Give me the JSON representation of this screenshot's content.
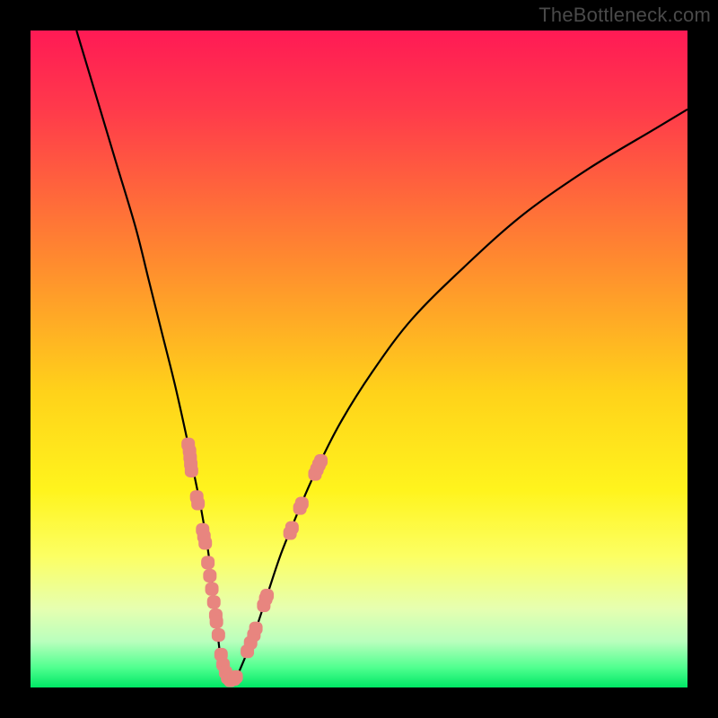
{
  "watermark": "TheBottleneck.com",
  "colors": {
    "curve_stroke": "#000000",
    "marker_fill": "#e8857f",
    "gradient_stops": [
      {
        "offset": "0%",
        "color": "#ff1a55"
      },
      {
        "offset": "12%",
        "color": "#ff3a4b"
      },
      {
        "offset": "35%",
        "color": "#ff8a2f"
      },
      {
        "offset": "55%",
        "color": "#ffd21a"
      },
      {
        "offset": "70%",
        "color": "#fff41d"
      },
      {
        "offset": "80%",
        "color": "#fcff63"
      },
      {
        "offset": "88%",
        "color": "#e6ffb0"
      },
      {
        "offset": "93%",
        "color": "#b9ffbd"
      },
      {
        "offset": "97%",
        "color": "#4fff8f"
      },
      {
        "offset": "100%",
        "color": "#00e765"
      }
    ]
  },
  "chart_data": {
    "type": "line",
    "title": "",
    "xlabel": "",
    "ylabel": "",
    "xlim": [
      0,
      100
    ],
    "ylim": [
      0,
      100
    ],
    "series": [
      {
        "name": "bottleneck-curve",
        "x": [
          7,
          10,
          13,
          16,
          18,
          20,
          22,
          24,
          25,
          26,
          27,
          27.5,
          28,
          28.5,
          29,
          29.5,
          30,
          31,
          32,
          34,
          36,
          38,
          40,
          43,
          47,
          52,
          58,
          66,
          75,
          85,
          95,
          100
        ],
        "y": [
          100,
          90,
          80,
          70,
          62,
          54,
          46,
          37,
          32,
          27,
          21,
          17,
          12,
          8,
          4,
          2,
          1,
          1,
          3,
          8,
          14,
          20,
          25,
          32,
          40,
          48,
          56,
          64,
          72,
          79,
          85,
          88
        ]
      }
    ],
    "markers": {
      "name": "highlight-points",
      "points": [
        {
          "x": 24.0,
          "y": 37
        },
        {
          "x": 24.2,
          "y": 36
        },
        {
          "x": 24.3,
          "y": 35
        },
        {
          "x": 24.4,
          "y": 34
        },
        {
          "x": 24.5,
          "y": 33
        },
        {
          "x": 25.3,
          "y": 29
        },
        {
          "x": 25.5,
          "y": 28
        },
        {
          "x": 26.2,
          "y": 24
        },
        {
          "x": 26.4,
          "y": 23
        },
        {
          "x": 26.6,
          "y": 22
        },
        {
          "x": 27.0,
          "y": 19
        },
        {
          "x": 27.3,
          "y": 17
        },
        {
          "x": 27.6,
          "y": 15
        },
        {
          "x": 27.9,
          "y": 13
        },
        {
          "x": 28.2,
          "y": 11
        },
        {
          "x": 28.3,
          "y": 10
        },
        {
          "x": 28.6,
          "y": 8
        },
        {
          "x": 29.0,
          "y": 5
        },
        {
          "x": 29.3,
          "y": 3.5
        },
        {
          "x": 29.7,
          "y": 2.3
        },
        {
          "x": 30.0,
          "y": 1.5
        },
        {
          "x": 30.4,
          "y": 1.1
        },
        {
          "x": 31.0,
          "y": 1.3
        },
        {
          "x": 31.3,
          "y": 1.6
        },
        {
          "x": 33.0,
          "y": 5.5
        },
        {
          "x": 33.5,
          "y": 6.8
        },
        {
          "x": 34.0,
          "y": 8
        },
        {
          "x": 34.3,
          "y": 9
        },
        {
          "x": 35.5,
          "y": 12.5
        },
        {
          "x": 35.8,
          "y": 13.5
        },
        {
          "x": 36.0,
          "y": 14
        },
        {
          "x": 39.5,
          "y": 23.5
        },
        {
          "x": 39.8,
          "y": 24.3
        },
        {
          "x": 41.0,
          "y": 27.3
        },
        {
          "x": 41.3,
          "y": 28
        },
        {
          "x": 43.3,
          "y": 32.5
        },
        {
          "x": 43.6,
          "y": 33.2
        },
        {
          "x": 43.9,
          "y": 33.9
        },
        {
          "x": 44.2,
          "y": 34.5
        }
      ]
    }
  }
}
